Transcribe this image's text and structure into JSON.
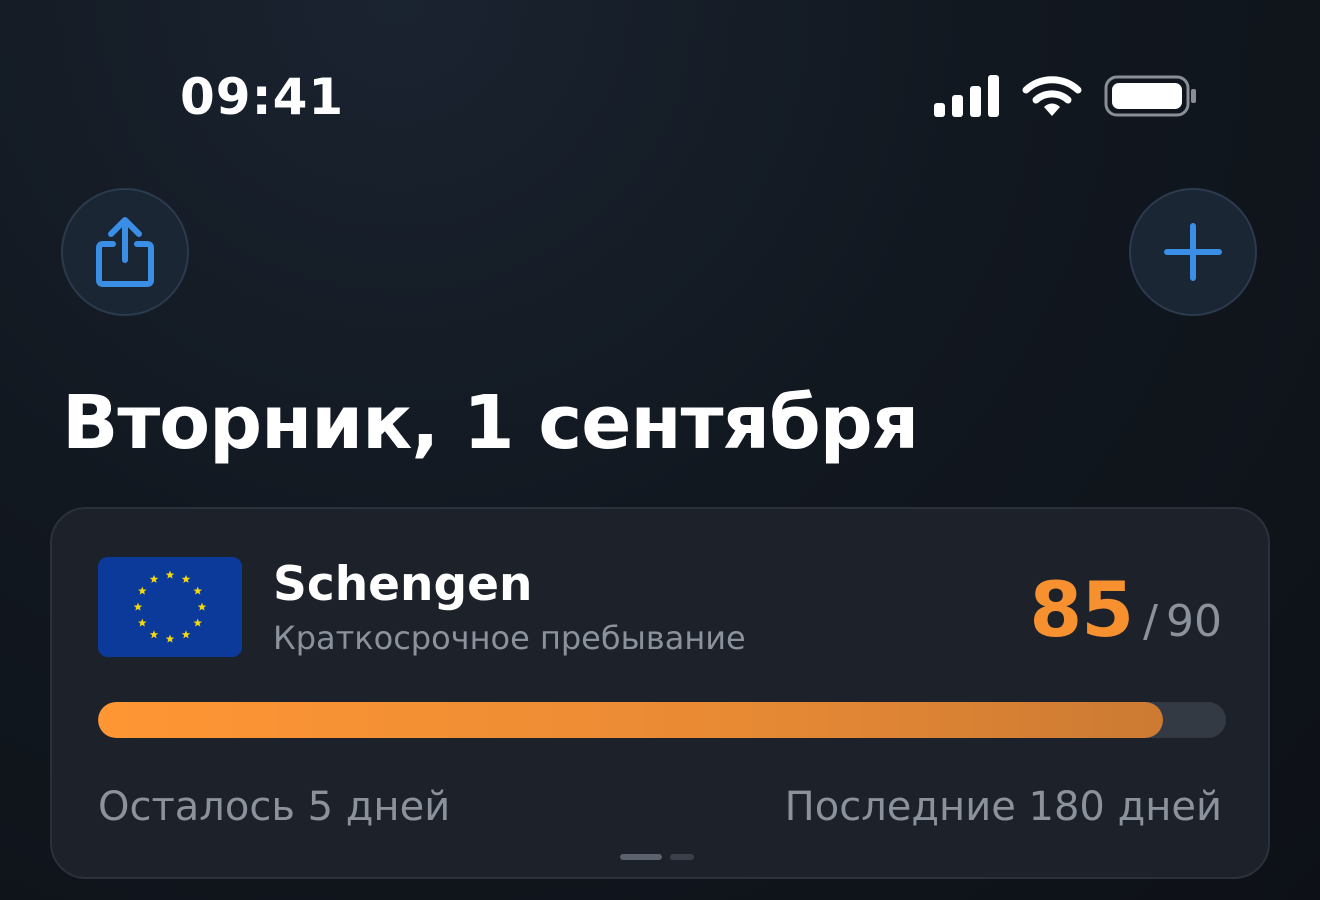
{
  "status_bar": {
    "time": "09:41",
    "icons": [
      "signal-icon",
      "wifi-icon",
      "battery-icon"
    ]
  },
  "toolbar": {
    "share_icon": "share-icon",
    "add_icon": "plus-icon",
    "accent": "#3a8ee6"
  },
  "page": {
    "title": "Вторник, 1 сентября"
  },
  "card": {
    "flag_icon": "eu-flag-icon",
    "zone_name": "Schengen",
    "zone_subtitle": "Краткосрочное пребывание",
    "days_used": "85",
    "slash": "/",
    "days_limit": "90",
    "progress_fraction": 0.944,
    "remaining_label": "Осталось 5 дней",
    "window_label": "Последние 180 дней",
    "accent": "#f7912f",
    "pager": {
      "count": 2,
      "active": 0
    }
  }
}
